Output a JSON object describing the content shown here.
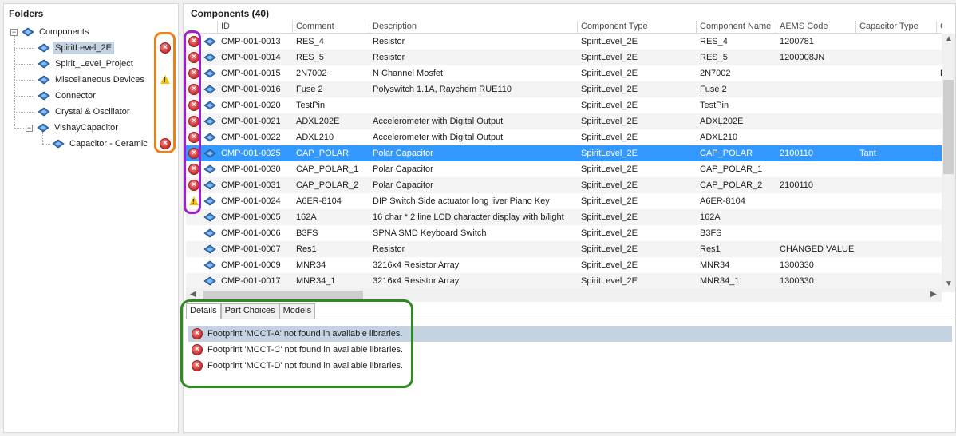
{
  "folders": {
    "title": "Folders",
    "items": [
      {
        "label": "Components",
        "status": ""
      },
      {
        "label": "SpiritLevel_2E",
        "status": "error"
      },
      {
        "label": "Spirit_Level_Project",
        "status": ""
      },
      {
        "label": "Miscellaneous Devices",
        "status": "warning"
      },
      {
        "label": "Connector",
        "status": ""
      },
      {
        "label": "Crystal & Oscillator",
        "status": ""
      },
      {
        "label": "VishayCapacitor",
        "status": ""
      },
      {
        "label": "Capacitor - Ceramic",
        "status": "error"
      }
    ]
  },
  "components": {
    "title": "Components (40)",
    "columns": [
      "ID",
      "Comment",
      "Description",
      "Component Type",
      "Component Name",
      "AEMS Code",
      "Capacitor Type",
      "Cate"
    ],
    "rows": [
      {
        "status": "error",
        "cells": [
          "CMP-001-0013",
          "RES_4",
          "Resistor",
          "SpiritLevel_2E",
          "RES_4",
          "1200781",
          "",
          ""
        ]
      },
      {
        "status": "error",
        "cells": [
          "CMP-001-0014",
          "RES_5",
          "Resistor",
          "SpiritLevel_2E",
          "RES_5",
          "1200008JN",
          "",
          ""
        ]
      },
      {
        "status": "error",
        "cells": [
          "CMP-001-0015",
          "2N7002",
          "N Channel Mosfet",
          "SpiritLevel_2E",
          "2N7002",
          "",
          "",
          "F"
        ]
      },
      {
        "status": "error",
        "cells": [
          "CMP-001-0016",
          "Fuse 2",
          "Polyswitch 1.1A, Raychem RUE110",
          "SpiritLevel_2E",
          "Fuse 2",
          "",
          "",
          ""
        ]
      },
      {
        "status": "error",
        "cells": [
          "CMP-001-0020",
          "TestPin",
          "",
          "SpiritLevel_2E",
          "TestPin",
          "",
          "",
          ""
        ]
      },
      {
        "status": "error",
        "cells": [
          "CMP-001-0021",
          "ADXL202E",
          "Accelerometer with Digital Output",
          "SpiritLevel_2E",
          "ADXL202E",
          "",
          "",
          ""
        ]
      },
      {
        "status": "error",
        "cells": [
          "CMP-001-0022",
          "ADXL210",
          "Accelerometer with Digital Output",
          "SpiritLevel_2E",
          "ADXL210",
          "",
          "",
          ""
        ]
      },
      {
        "status": "error",
        "cells": [
          "CMP-001-0025",
          "CAP_POLAR",
          "Polar Capacitor",
          "SpiritLevel_2E",
          "CAP_POLAR",
          "2100110",
          "Tant",
          ""
        ]
      },
      {
        "status": "error",
        "cells": [
          "CMP-001-0030",
          "CAP_POLAR_1",
          "Polar Capacitor",
          "SpiritLevel_2E",
          "CAP_POLAR_1",
          "",
          "",
          ""
        ]
      },
      {
        "status": "error",
        "cells": [
          "CMP-001-0031",
          "CAP_POLAR_2",
          "Polar Capacitor",
          "SpiritLevel_2E",
          "CAP_POLAR_2",
          "2100110",
          "",
          ""
        ]
      },
      {
        "status": "warning",
        "cells": [
          "CMP-001-0024",
          "A6ER-8104",
          "DIP Switch Side actuator long liver Piano Key",
          "SpiritLevel_2E",
          "A6ER-8104",
          "",
          "",
          ""
        ]
      },
      {
        "status": "",
        "cells": [
          "CMP-001-0005",
          "162A",
          "16 char * 2 line LCD character display with b/light",
          "SpiritLevel_2E",
          "162A",
          "",
          "",
          ""
        ]
      },
      {
        "status": "",
        "cells": [
          "CMP-001-0006",
          "B3FS",
          "SPNA SMD Keyboard Switch",
          "SpiritLevel_2E",
          "B3FS",
          "",
          "",
          ""
        ]
      },
      {
        "status": "",
        "cells": [
          "CMP-001-0007",
          "Res1",
          "Resistor",
          "SpiritLevel_2E",
          "Res1",
          "CHANGED VALUE",
          "",
          ""
        ]
      },
      {
        "status": "",
        "cells": [
          "CMP-001-0009",
          "MNR34",
          "3216x4 Resistor Array",
          "SpiritLevel_2E",
          "MNR34",
          "1300330",
          "",
          ""
        ]
      },
      {
        "status": "",
        "cells": [
          "CMP-001-0017",
          "MNR34_1",
          "3216x4 Resistor Array",
          "SpiritLevel_2E",
          "MNR34_1",
          "1300330",
          "",
          ""
        ]
      }
    ],
    "selected_row": 7
  },
  "tabs": [
    {
      "label": "Details",
      "active": true
    },
    {
      "label": "Part Choices",
      "active": false
    },
    {
      "label": "Models",
      "active": false
    }
  ],
  "details": {
    "messages": [
      {
        "text": "Footprint 'MCCT-A' not found in available libraries.",
        "selected": true
      },
      {
        "text": "Footprint 'MCCT-C' not found in available libraries.",
        "selected": false
      },
      {
        "text": "Footprint 'MCCT-D' not found in available libraries.",
        "selected": false
      }
    ]
  },
  "colors": {
    "selection": "#3399ff",
    "highlight_folders": "#f07f1a",
    "highlight_status": "#a020d0",
    "highlight_details": "#2e8b1e"
  }
}
